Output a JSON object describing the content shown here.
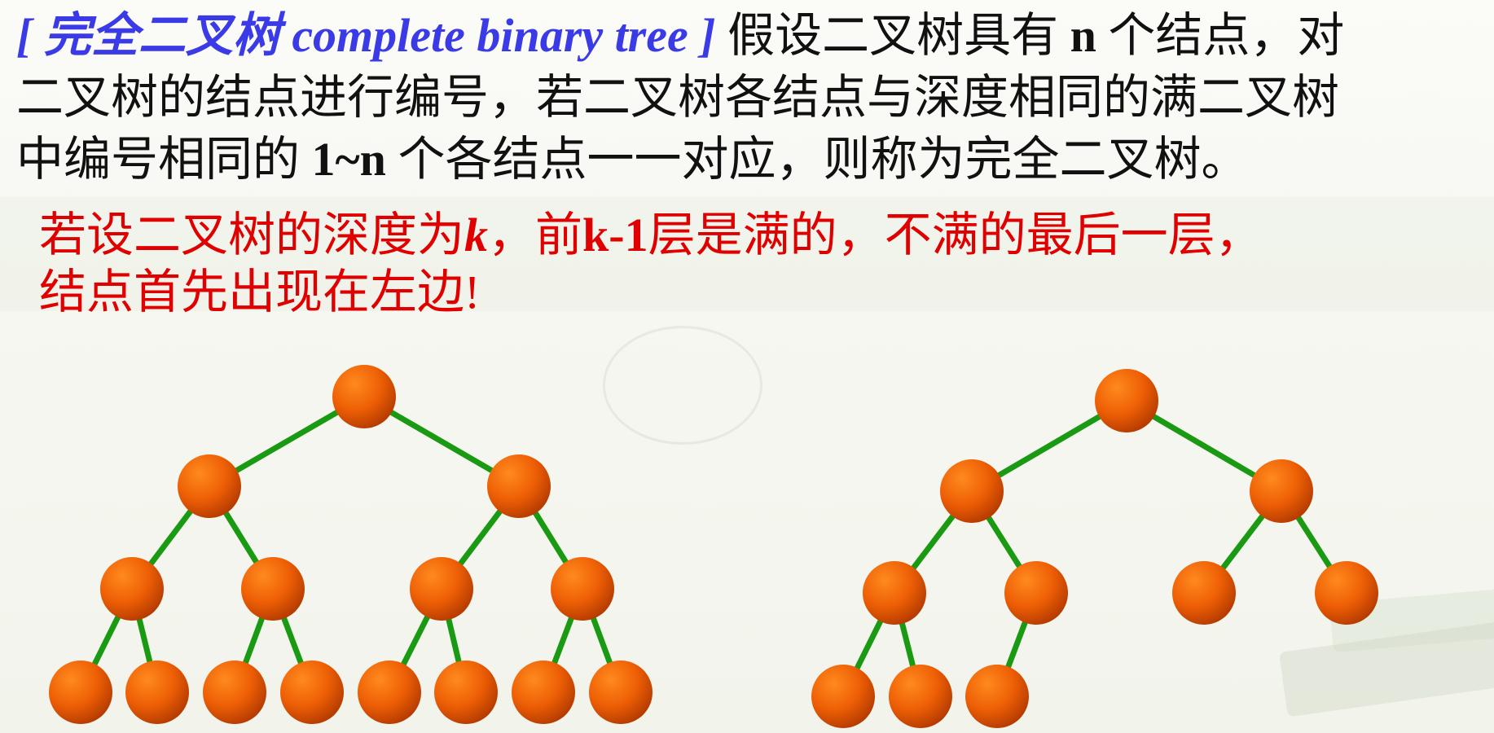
{
  "definition": {
    "term": "[ 完全二叉树 complete binary tree ]",
    "line1_a": "假设二叉树具有",
    "line1_n": "n",
    "line1_b": "个结点，对",
    "line2": "二叉树的结点进行编号，若二叉树各结点与深度相同的满二叉树",
    "line3_a": "中编号相同的",
    "line3_range": "1~n",
    "line3_b": "个各结点一一对应，则称为完全二叉树。"
  },
  "note": {
    "a": "若设二叉树的深度为",
    "k": "k",
    "b": "，前",
    "kminus": "k-1",
    "c": "层是满的，不满的最后一层，",
    "line2": "结点首先出现在左边!"
  },
  "colors": {
    "term": "#3a3ae6",
    "note": "#e00000",
    "node": "#f06408",
    "edge": "#1a9a12"
  },
  "trees": [
    {
      "kind": "full",
      "levels": 4,
      "nodes": 15,
      "edges": [
        [
          0,
          1
        ],
        [
          0,
          2
        ],
        [
          1,
          3
        ],
        [
          1,
          4
        ],
        [
          2,
          5
        ],
        [
          2,
          6
        ],
        [
          3,
          7
        ],
        [
          3,
          8
        ],
        [
          4,
          9
        ],
        [
          4,
          10
        ],
        [
          5,
          11
        ],
        [
          5,
          12
        ],
        [
          6,
          13
        ],
        [
          6,
          14
        ]
      ]
    },
    {
      "kind": "complete",
      "levels": 4,
      "nodes": 10,
      "edges": [
        [
          0,
          1
        ],
        [
          0,
          2
        ],
        [
          1,
          3
        ],
        [
          1,
          4
        ],
        [
          2,
          5
        ],
        [
          2,
          6
        ],
        [
          3,
          7
        ],
        [
          3,
          8
        ],
        [
          4,
          9
        ]
      ]
    }
  ]
}
